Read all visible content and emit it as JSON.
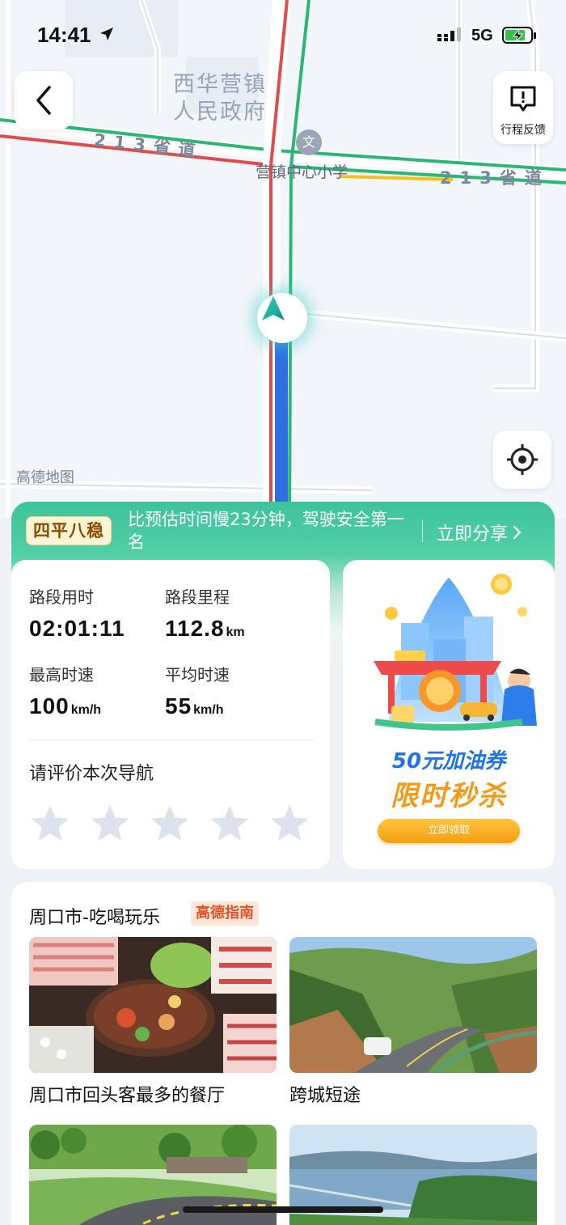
{
  "status_bar": {
    "time": "14:41",
    "network": "5G"
  },
  "map": {
    "government_label": "西华营镇\n人民政府",
    "road_label_left": "213省道",
    "road_label_right": "213省道",
    "school_label": "营镇中心小学",
    "school_pin": "文",
    "brand_label": "高德地图",
    "route_colors": {
      "traveled": "#2f6fe0",
      "green": "#2bb673",
      "red": "#e24b4b",
      "yellow": "#f2c21b"
    }
  },
  "header": {
    "feedback_label": "行程反馈"
  },
  "summary": {
    "badge": "四平八稳",
    "text": "比预估时间慢23分钟，驾驶安全第一名",
    "share_label": "立即分享"
  },
  "stats": {
    "duration_label": "路段用时",
    "duration_value": "02:01:11",
    "distance_label": "路段里程",
    "distance_value": "112.8",
    "distance_unit": "km",
    "max_speed_label": "最高时速",
    "max_speed_value": "100",
    "max_speed_unit": "km/h",
    "avg_speed_label": "平均时速",
    "avg_speed_value": "55",
    "avg_speed_unit": "km/h",
    "rating_prompt": "请评价本次导航",
    "rating_stars_total": 5,
    "rating_value": 0
  },
  "ad": {
    "title_line1": "50元加油券",
    "title_line2": "限时秒杀",
    "button_label": "立即领取"
  },
  "guide": {
    "title": "周口市-吃喝玩乐",
    "tag": "高德指南",
    "items": [
      {
        "caption": "周口市回头客最多的餐厅"
      },
      {
        "caption": "跨城短途"
      },
      {
        "caption": ""
      },
      {
        "caption": ""
      }
    ]
  }
}
